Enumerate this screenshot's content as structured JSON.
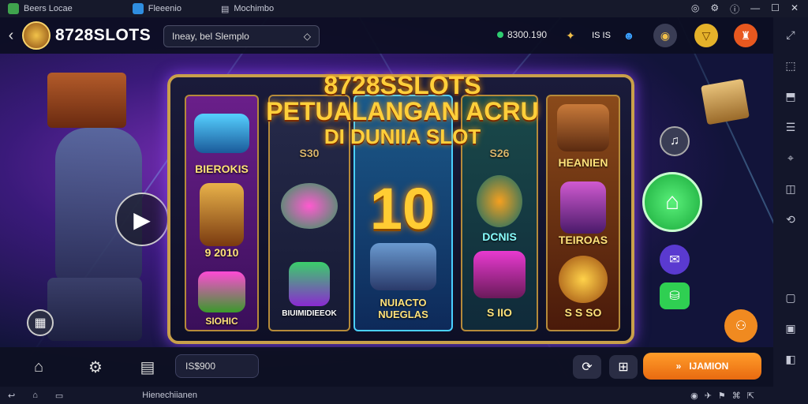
{
  "window": {
    "tabs": [
      {
        "label": "Beers Locae",
        "color": "#3fa34d"
      },
      {
        "label": "Fleeenio",
        "color": "#2f8ee0"
      },
      {
        "label": "Mochimbo",
        "color": "#666a80"
      }
    ],
    "controls": [
      "circle-icon",
      "gear-icon",
      "info-icon",
      "minimize-icon",
      "maximize-icon",
      "close-icon"
    ]
  },
  "header": {
    "brand": "8728SLOTS",
    "search_value": "Ineay, bel Slemplo",
    "balance": "8300.190",
    "icon_text_1": "IS IS"
  },
  "board": {
    "title_line1": "8728SSLOTS",
    "title_line2": "PETUALANGAN ACRU",
    "title_line3": "DI DUNIIA SLOT",
    "big_number": "10",
    "left_top_label": "BIEROKIS",
    "left_mid_label": "9 2010",
    "left_bottom_label": "SIOHIC",
    "reel2_top_label": "S30",
    "reel2_bottom_label": "BIUIMIDIEEOK",
    "center_bottom_label": "NUIACTO NUEGLAS",
    "reel4_top_label": "S26",
    "reel4_mid_label": "DCNIS",
    "reel4_bottom_label": "S IIO",
    "right_top_label": "HEANIEN",
    "right_mid_label": "TEIROAS",
    "right_bottom_label": "S S SO"
  },
  "footer": {
    "field_value": "IS$900",
    "cta_label": "IJAMION"
  },
  "statusbar": {
    "label": "Hienechiianen"
  },
  "colors": {
    "accent_gold": "#c9a04a",
    "cta_orange": "#f08020",
    "green_button": "#2fcf52"
  }
}
